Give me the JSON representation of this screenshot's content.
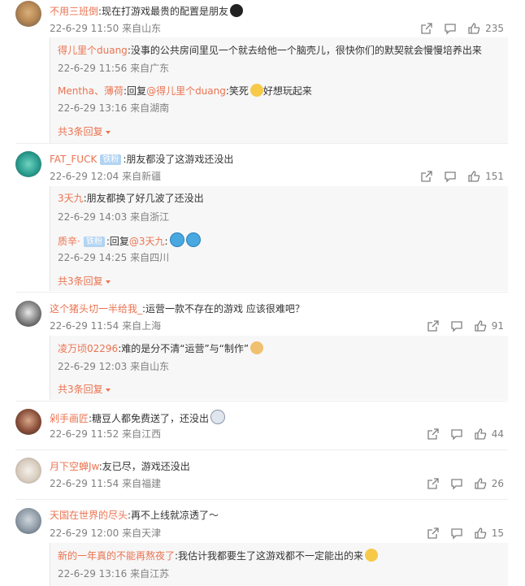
{
  "comments": [
    {
      "user": "不用三班倒",
      "text": ":现在打游戏最贵的配置是朋友",
      "emoji": "black-face-emoji",
      "date": "22-6-29 11:50",
      "location": "来自山东",
      "likes": "235",
      "replies": [
        {
          "user": "得儿里个duang",
          "text": ":没事的公共房间里见一个就去给他一个脑壳儿，很快你们的默契就会慢慢培养出来",
          "date": "22-6-29 11:56",
          "location": "来自广东"
        },
        {
          "user": "Mentha、薄荷",
          "reply_prefix": ":回复",
          "reply_to": "@得儿里个duang",
          "text": ":笑死",
          "text2": "好想玩起来",
          "emoji": "laugh-cry-emoji",
          "date": "22-6-29 13:16",
          "location": "来自湖南"
        }
      ],
      "more_replies": "共3条回复"
    },
    {
      "user": "FAT_FUCK",
      "badge": "铁粉",
      "text": ":朋友都没了这游戏还没出",
      "date": "22-6-29 12:04",
      "location": "来自新疆",
      "likes": "151",
      "replies": [
        {
          "user": "3天九",
          "text": ":朋友都换了好几波了还没出",
          "date": "22-6-29 14:03",
          "location": "来自浙江"
        },
        {
          "user": "质辛·",
          "badge": "铁粉",
          "reply_prefix": ":回复",
          "reply_to": "@3天九",
          "text": ":",
          "emoji": "doraemon-emoji",
          "date": "22-6-29 14:25",
          "location": "来自四川"
        }
      ],
      "more_replies": "共3条回复"
    },
    {
      "user": "这个猪头切一半给我_",
      "text": ":运营一款不存在的游戏 应该很难吧？",
      "date": "22-6-29 11:54",
      "location": "来自上海",
      "likes": "91",
      "replies": [
        {
          "user": "凌万顷02296",
          "text": ":难的是分不清“运营”与“制作”",
          "emoji": "doge-emoji",
          "date": "22-6-29 12:03",
          "location": "来自山东"
        }
      ],
      "more_replies": "共3条回复"
    },
    {
      "user": "剁手画匠",
      "text": ":糖豆人都免费送了，还没出",
      "emoji": "crying-emoji",
      "date": "22-6-29 11:52",
      "location": "来自江西",
      "likes": "44"
    },
    {
      "user": "月下空蝉Jw",
      "text": ":友已尽，游戏还没出",
      "date": "22-6-29 11:54",
      "location": "来自福建",
      "likes": "26"
    },
    {
      "user": "天国在世界的尽头",
      "text": ":再不上线就凉透了～",
      "date": "22-6-29 12:00",
      "location": "来自天津",
      "likes": "15",
      "replies": [
        {
          "user": "新的一年真的不能再熬夜了",
          "text": ":我估计我都要生了这游戏都不一定能出的来",
          "emoji": "shrug-emoji",
          "date": "22-6-29 13:16",
          "location": "来自江苏"
        }
      ]
    }
  ]
}
